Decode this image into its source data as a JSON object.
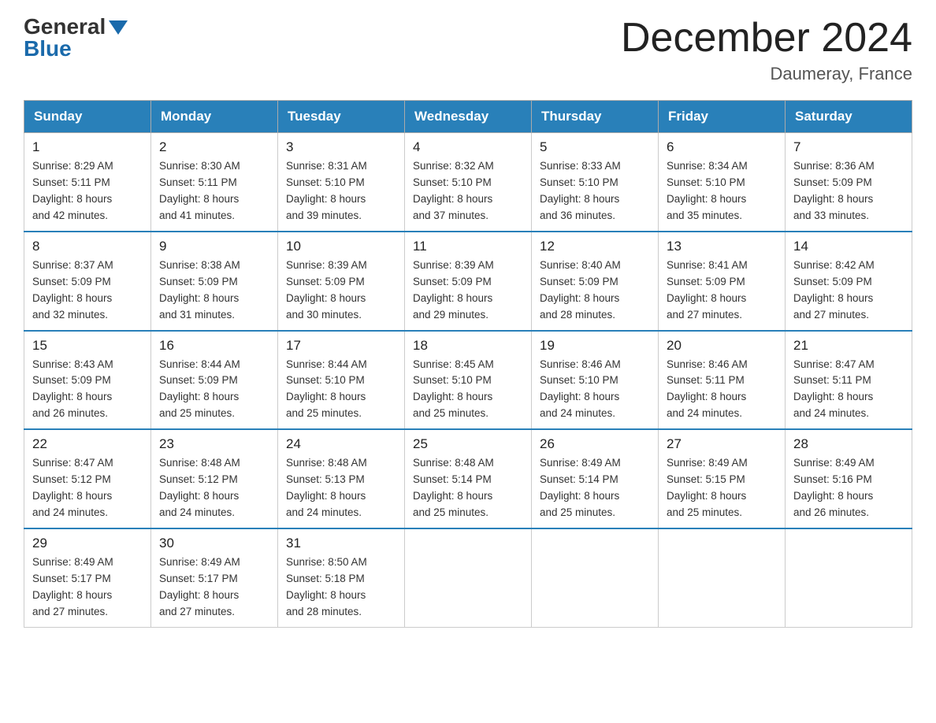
{
  "header": {
    "logo_general": "General",
    "logo_blue": "Blue",
    "month_title": "December 2024",
    "location": "Daumeray, France"
  },
  "days_of_week": [
    "Sunday",
    "Monday",
    "Tuesday",
    "Wednesday",
    "Thursday",
    "Friday",
    "Saturday"
  ],
  "weeks": [
    [
      {
        "day": "1",
        "sunrise": "8:29 AM",
        "sunset": "5:11 PM",
        "daylight": "8 hours and 42 minutes."
      },
      {
        "day": "2",
        "sunrise": "8:30 AM",
        "sunset": "5:11 PM",
        "daylight": "8 hours and 41 minutes."
      },
      {
        "day": "3",
        "sunrise": "8:31 AM",
        "sunset": "5:10 PM",
        "daylight": "8 hours and 39 minutes."
      },
      {
        "day": "4",
        "sunrise": "8:32 AM",
        "sunset": "5:10 PM",
        "daylight": "8 hours and 37 minutes."
      },
      {
        "day": "5",
        "sunrise": "8:33 AM",
        "sunset": "5:10 PM",
        "daylight": "8 hours and 36 minutes."
      },
      {
        "day": "6",
        "sunrise": "8:34 AM",
        "sunset": "5:10 PM",
        "daylight": "8 hours and 35 minutes."
      },
      {
        "day": "7",
        "sunrise": "8:36 AM",
        "sunset": "5:09 PM",
        "daylight": "8 hours and 33 minutes."
      }
    ],
    [
      {
        "day": "8",
        "sunrise": "8:37 AM",
        "sunset": "5:09 PM",
        "daylight": "8 hours and 32 minutes."
      },
      {
        "day": "9",
        "sunrise": "8:38 AM",
        "sunset": "5:09 PM",
        "daylight": "8 hours and 31 minutes."
      },
      {
        "day": "10",
        "sunrise": "8:39 AM",
        "sunset": "5:09 PM",
        "daylight": "8 hours and 30 minutes."
      },
      {
        "day": "11",
        "sunrise": "8:39 AM",
        "sunset": "5:09 PM",
        "daylight": "8 hours and 29 minutes."
      },
      {
        "day": "12",
        "sunrise": "8:40 AM",
        "sunset": "5:09 PM",
        "daylight": "8 hours and 28 minutes."
      },
      {
        "day": "13",
        "sunrise": "8:41 AM",
        "sunset": "5:09 PM",
        "daylight": "8 hours and 27 minutes."
      },
      {
        "day": "14",
        "sunrise": "8:42 AM",
        "sunset": "5:09 PM",
        "daylight": "8 hours and 27 minutes."
      }
    ],
    [
      {
        "day": "15",
        "sunrise": "8:43 AM",
        "sunset": "5:09 PM",
        "daylight": "8 hours and 26 minutes."
      },
      {
        "day": "16",
        "sunrise": "8:44 AM",
        "sunset": "5:09 PM",
        "daylight": "8 hours and 25 minutes."
      },
      {
        "day": "17",
        "sunrise": "8:44 AM",
        "sunset": "5:10 PM",
        "daylight": "8 hours and 25 minutes."
      },
      {
        "day": "18",
        "sunrise": "8:45 AM",
        "sunset": "5:10 PM",
        "daylight": "8 hours and 25 minutes."
      },
      {
        "day": "19",
        "sunrise": "8:46 AM",
        "sunset": "5:10 PM",
        "daylight": "8 hours and 24 minutes."
      },
      {
        "day": "20",
        "sunrise": "8:46 AM",
        "sunset": "5:11 PM",
        "daylight": "8 hours and 24 minutes."
      },
      {
        "day": "21",
        "sunrise": "8:47 AM",
        "sunset": "5:11 PM",
        "daylight": "8 hours and 24 minutes."
      }
    ],
    [
      {
        "day": "22",
        "sunrise": "8:47 AM",
        "sunset": "5:12 PM",
        "daylight": "8 hours and 24 minutes."
      },
      {
        "day": "23",
        "sunrise": "8:48 AM",
        "sunset": "5:12 PM",
        "daylight": "8 hours and 24 minutes."
      },
      {
        "day": "24",
        "sunrise": "8:48 AM",
        "sunset": "5:13 PM",
        "daylight": "8 hours and 24 minutes."
      },
      {
        "day": "25",
        "sunrise": "8:48 AM",
        "sunset": "5:14 PM",
        "daylight": "8 hours and 25 minutes."
      },
      {
        "day": "26",
        "sunrise": "8:49 AM",
        "sunset": "5:14 PM",
        "daylight": "8 hours and 25 minutes."
      },
      {
        "day": "27",
        "sunrise": "8:49 AM",
        "sunset": "5:15 PM",
        "daylight": "8 hours and 25 minutes."
      },
      {
        "day": "28",
        "sunrise": "8:49 AM",
        "sunset": "5:16 PM",
        "daylight": "8 hours and 26 minutes."
      }
    ],
    [
      {
        "day": "29",
        "sunrise": "8:49 AM",
        "sunset": "5:17 PM",
        "daylight": "8 hours and 27 minutes."
      },
      {
        "day": "30",
        "sunrise": "8:49 AM",
        "sunset": "5:17 PM",
        "daylight": "8 hours and 27 minutes."
      },
      {
        "day": "31",
        "sunrise": "8:50 AM",
        "sunset": "5:18 PM",
        "daylight": "8 hours and 28 minutes."
      },
      null,
      null,
      null,
      null
    ]
  ],
  "labels": {
    "sunrise": "Sunrise:",
    "sunset": "Sunset:",
    "daylight": "Daylight:"
  }
}
